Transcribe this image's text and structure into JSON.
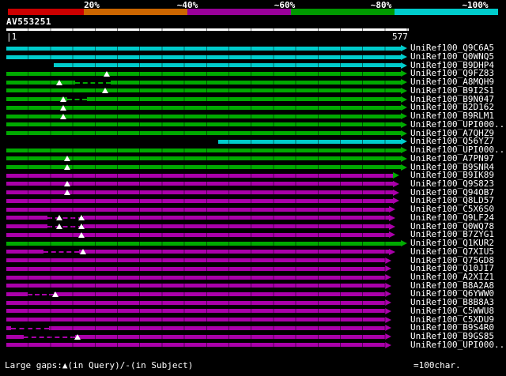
{
  "chart_data": {
    "type": "table",
    "title": "BLAST graphical overview",
    "identity_legend": [
      {
        "label": "20%",
        "color": "#cc0000"
      },
      {
        "label": "~40%",
        "color": "#cc6600"
      },
      {
        "label": "~60%",
        "color": "#990099"
      },
      {
        "label": "~80%",
        "color": "#009900"
      },
      {
        "label": "~100%",
        "color": "#00cccc"
      }
    ],
    "colors": {
      "cyan": "#00cccc",
      "green": "#00aa00",
      "magenta": "#aa00aa"
    },
    "query": {
      "name": "AV553251",
      "length": 577,
      "ruler_left": "|1",
      "ruler_right": "577"
    },
    "rows": [
      {
        "label": "UniRef100_Q9C6A5",
        "color": "cyan",
        "start": 1,
        "end": 577,
        "gaps": [],
        "thin": []
      },
      {
        "label": "UniRef100_Q0WNQ5",
        "color": "cyan",
        "start": 1,
        "end": 577,
        "gaps": [],
        "thin": []
      },
      {
        "label": "UniRef100_B9DHP4",
        "color": "cyan",
        "start": 69,
        "end": 577,
        "gaps": [],
        "thin": []
      },
      {
        "label": "UniRef100_Q9FZ83",
        "color": "green",
        "start": 1,
        "end": 577,
        "gaps": [
          145
        ],
        "thin": []
      },
      {
        "label": "UniRef100_A8MQH9",
        "color": "green",
        "start": 1,
        "end": 577,
        "gaps": [
          77
        ],
        "thin": [
          [
            100,
            151
          ]
        ]
      },
      {
        "label": "UniRef100_B9I2S1",
        "color": "green",
        "start": 1,
        "end": 577,
        "gaps": [
          143
        ],
        "thin": []
      },
      {
        "label": "UniRef100_B9N047",
        "color": "green",
        "start": 1,
        "end": 577,
        "gaps": [
          83
        ],
        "thin": [
          [
            89,
            117
          ]
        ]
      },
      {
        "label": "UniRef100_B2D162",
        "color": "green",
        "start": 1,
        "end": 577,
        "gaps": [
          83
        ],
        "thin": []
      },
      {
        "label": "UniRef100_B9RLM1",
        "color": "green",
        "start": 1,
        "end": 577,
        "gaps": [
          83
        ],
        "thin": []
      },
      {
        "label": "UniRef100_UPI000..",
        "color": "green",
        "start": 1,
        "end": 577,
        "gaps": [],
        "thin": []
      },
      {
        "label": "UniRef100_A7QHZ9",
        "color": "green",
        "start": 1,
        "end": 577,
        "gaps": [],
        "thin": []
      },
      {
        "label": "UniRef100_Q56YZ7",
        "color": "cyan",
        "start": 305,
        "end": 577,
        "gaps": [],
        "thin": []
      },
      {
        "label": "UniRef100_UPI000..",
        "color": "green",
        "start": 1,
        "end": 577,
        "gaps": [],
        "thin": []
      },
      {
        "label": "UniRef100_A7PN97",
        "color": "green",
        "start": 1,
        "end": 577,
        "gaps": [
          88
        ],
        "thin": []
      },
      {
        "label": "UniRef100_B9SNR4",
        "color": "green",
        "start": 1,
        "end": 577,
        "gaps": [
          88
        ],
        "thin": []
      },
      {
        "label": "UniRef100_B9IK89",
        "color": "magenta",
        "start": 1,
        "end": 566,
        "gaps": [],
        "thin": [],
        "arrow_color": "green"
      },
      {
        "label": "UniRef100_Q9S823",
        "color": "magenta",
        "start": 1,
        "end": 566,
        "gaps": [
          88
        ],
        "thin": []
      },
      {
        "label": "UniRef100_Q94OB7",
        "color": "magenta",
        "start": 1,
        "end": 566,
        "gaps": [
          88
        ],
        "thin": []
      },
      {
        "label": "UniRef100_Q8LD57",
        "color": "magenta",
        "start": 1,
        "end": 566,
        "gaps": [],
        "thin": []
      },
      {
        "label": "UniRef100_C5X6S0",
        "color": "magenta",
        "start": 1,
        "end": 560,
        "gaps": [],
        "thin": []
      },
      {
        "label": "UniRef100_Q9LF24",
        "color": "magenta",
        "start": 1,
        "end": 560,
        "gaps": [
          77,
          109
        ],
        "thin": [
          [
            60,
            111
          ]
        ]
      },
      {
        "label": "UniRef100_Q0WQ78",
        "color": "magenta",
        "start": 1,
        "end": 560,
        "gaps": [
          77,
          109
        ],
        "thin": [
          [
            60,
            111
          ]
        ]
      },
      {
        "label": "UniRef100_B7ZYG1",
        "color": "magenta",
        "start": 1,
        "end": 560,
        "gaps": [
          109
        ],
        "thin": []
      },
      {
        "label": "UniRef100_Q1KUR2",
        "color": "green",
        "start": 1,
        "end": 577,
        "gaps": [],
        "thin": []
      },
      {
        "label": "UniRef100_Q7XIU5",
        "color": "magenta",
        "start": 1,
        "end": 560,
        "gaps": [
          111
        ],
        "thin": [
          [
            54,
            106
          ]
        ]
      },
      {
        "label": "UniRef100_Q75GD8",
        "color": "magenta",
        "start": 1,
        "end": 554,
        "gaps": [],
        "thin": []
      },
      {
        "label": "UniRef100_Q10JI7",
        "color": "magenta",
        "start": 1,
        "end": 554,
        "gaps": [],
        "thin": []
      },
      {
        "label": "UniRef100_A2XIZ1",
        "color": "magenta",
        "start": 1,
        "end": 554,
        "gaps": [],
        "thin": []
      },
      {
        "label": "UniRef100_B8A2A8",
        "color": "magenta",
        "start": 1,
        "end": 554,
        "gaps": [],
        "thin": []
      },
      {
        "label": "UniRef100_Q6YWW0",
        "color": "magenta",
        "start": 1,
        "end": 554,
        "gaps": [
          71
        ],
        "thin": [
          [
            32,
            69
          ]
        ]
      },
      {
        "label": "UniRef100_B8B8A3",
        "color": "magenta",
        "start": 1,
        "end": 554,
        "gaps": [],
        "thin": []
      },
      {
        "label": "UniRef100_C5WWU8",
        "color": "magenta",
        "start": 1,
        "end": 554,
        "gaps": [],
        "thin": []
      },
      {
        "label": "UniRef100_C5XDU9",
        "color": "magenta",
        "start": 1,
        "end": 554,
        "gaps": [],
        "thin": []
      },
      {
        "label": "UniRef100_B9S4R0",
        "color": "magenta",
        "start": 1,
        "end": 554,
        "gaps": [],
        "thin": [
          [
            8,
            62
          ]
        ]
      },
      {
        "label": "UniRef100_B9GS85",
        "color": "magenta",
        "start": 1,
        "end": 554,
        "gaps": [
          103
        ],
        "thin": [
          [
            26,
            100
          ]
        ]
      },
      {
        "label": "UniRef100_UPI000..",
        "color": "magenta",
        "start": 1,
        "end": 554,
        "gaps": [],
        "thin": []
      }
    ],
    "footer": {
      "gaps_legend": "Large gaps:▲(in Query)/-(in Subject)",
      "scale_label": "=100char."
    }
  }
}
